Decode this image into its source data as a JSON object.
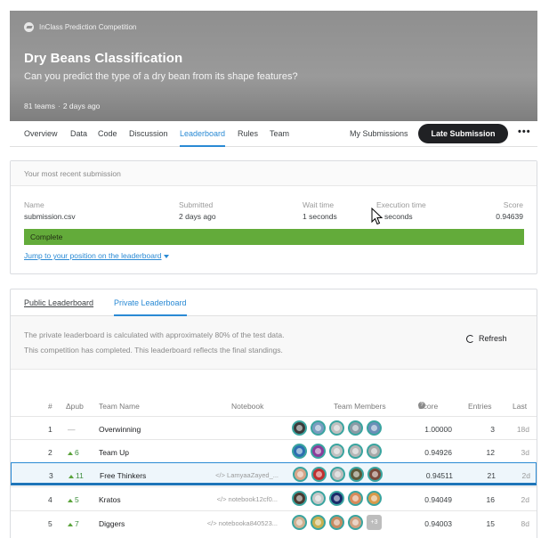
{
  "banner": {
    "kicker": "InClass Prediction Competition",
    "title": "Dry Beans Classification",
    "subtitle": "Can you predict the type of a dry bean from its shape features?",
    "teams": "81 teams",
    "time_ago": "2 days ago"
  },
  "tabs": [
    {
      "label": "Overview"
    },
    {
      "label": "Data"
    },
    {
      "label": "Code"
    },
    {
      "label": "Discussion"
    },
    {
      "label": "Leaderboard",
      "active": true
    },
    {
      "label": "Rules"
    },
    {
      "label": "Team"
    }
  ],
  "actions": {
    "my_submissions": "My Submissions",
    "late_submission": "Late Submission",
    "more": "•••"
  },
  "recent_submission": {
    "heading": "Your most recent submission",
    "name_label": "Name",
    "name_value": "submission.csv",
    "submitted_label": "Submitted",
    "submitted_value": "2 days ago",
    "wait_label": "Wait time",
    "wait_value": "1 seconds",
    "exec_label": "Execution time",
    "exec_value": "seconds",
    "score_label": "Score",
    "score_value": "0.94639",
    "status": "Complete",
    "jump_link": "Jump to your position on the leaderboard"
  },
  "leaderboard": {
    "public_tab": "Public Leaderboard",
    "private_tab": "Private Leaderboard",
    "info_line1": "The private leaderboard is calculated with approximately 80% of the test data.",
    "info_line2": "This competition has completed. This leaderboard reflects the final standings.",
    "refresh": "Refresh",
    "columns": {
      "rank": "#",
      "delta": "Δpub",
      "team": "Team Name",
      "notebook": "Notebook",
      "members": "Team Members",
      "score": "Score",
      "entries": "Entries",
      "last": "Last"
    },
    "rows": [
      {
        "rank": "1",
        "delta": "—",
        "team": "Overwinning",
        "notebook": "",
        "score": "1.00000",
        "entries": "3",
        "last": "18d",
        "avatars": [
          "#3b3b3b",
          "#7a9cc0",
          "#bfbfbf",
          "#8a9aa5",
          "#6b8fb8"
        ]
      },
      {
        "rank": "2",
        "delta": "6",
        "team": "Team Up",
        "notebook": "",
        "score": "0.94926",
        "entries": "12",
        "last": "3d",
        "avatars": [
          "#2d6fb0",
          "#8c3d9a",
          "#c0c0c0",
          "#b6b6b6",
          "#a8a8a8"
        ]
      },
      {
        "rank": "3",
        "delta": "11",
        "team": "Free Thinkers",
        "notebook": "</> LamyaaZayed_...",
        "score": "0.94511",
        "entries": "21",
        "last": "2d",
        "avatars": [
          "#d7a588",
          "#c03030",
          "#bdbdbd",
          "#5e5a3a",
          "#7a4a3a"
        ]
      },
      {
        "rank": "4",
        "delta": "5",
        "team": "Kratos",
        "notebook": "</> notebook12cf0...",
        "score": "0.94049",
        "entries": "16",
        "last": "2d",
        "avatars": [
          "#4a3a30",
          "#c8c8c8",
          "#1a2a6a",
          "#d88a5a",
          "#d89a4a"
        ]
      },
      {
        "rank": "5",
        "delta": "7",
        "team": "Diggers",
        "notebook": "</> notebooka840523...",
        "score": "0.94003",
        "entries": "15",
        "last": "8d",
        "avatars": [
          "#d0b090",
          "#c8b050",
          "#c88a60",
          "#d0a080"
        ],
        "more": "+3"
      }
    ]
  }
}
